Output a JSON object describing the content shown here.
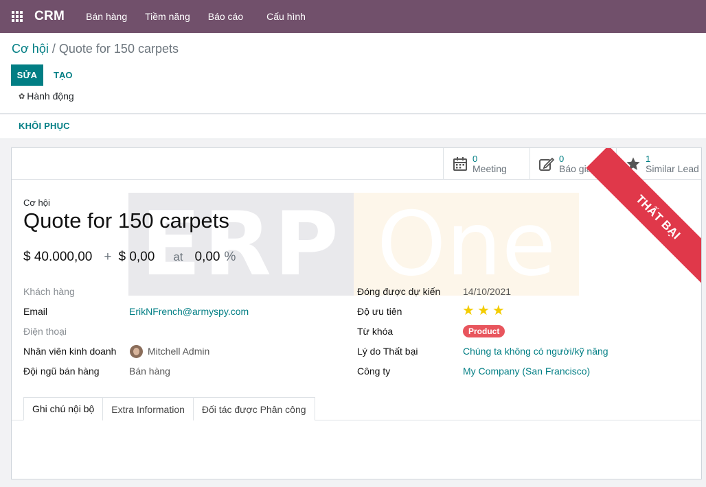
{
  "navbar": {
    "app_name": "CRM",
    "menu": [
      "Bán hàng",
      "Tiềm năng",
      "Báo cáo",
      "Cấu hình"
    ]
  },
  "breadcrumb": {
    "parent": "Cơ hội",
    "separator": "/",
    "current": "Quote for 150 carpets"
  },
  "buttons": {
    "edit": "SỬA",
    "create": "TẠO",
    "action": "Hành động",
    "restore": "KHÔI PHỤC"
  },
  "stat_buttons": [
    {
      "icon": "calendar-icon",
      "value": "0",
      "label": "Meeting"
    },
    {
      "icon": "edit-icon",
      "value": "0",
      "label": "Báo giá"
    },
    {
      "icon": "star-icon",
      "value": "1",
      "label": "Similar Lead"
    }
  ],
  "watermark": {
    "left": "ERP",
    "right": "One"
  },
  "ribbon": "THẤT BẠI",
  "record": {
    "type_label": "Cơ hội",
    "name": "Quote for 150 carpets",
    "expected_revenue": "$ 40.000,00",
    "plus": "+",
    "recurring_revenue": "$ 0,00",
    "at": "at",
    "probability": "0,00",
    "percent": "%"
  },
  "left_fields": {
    "customer_label": "Khách hàng",
    "email_label": "Email",
    "email_value": "ErikNFrench@armyspy.com",
    "phone_label": "Điện thoại",
    "salesperson_label": "Nhân viên kinh doanh",
    "salesperson_value": "Mitchell Admin",
    "team_label": "Đội ngũ bán hàng",
    "team_value": "Bán hàng"
  },
  "right_fields": {
    "deadline_label": "Đóng được dự kiến",
    "deadline_value": "14/10/2021",
    "priority_label": "Độ ưu tiên",
    "priority_stars": 3,
    "tags_label": "Từ khóa",
    "tag_value": "Product",
    "lost_reason_label": "Lý do Thất bại",
    "lost_reason_value": "Chúng ta không có người/kỹ năng",
    "company_label": "Công ty",
    "company_value": "My Company (San Francisco)"
  },
  "tabs": [
    "Ghi chú nội bộ",
    "Extra Information",
    "Đối tác được Phân công"
  ],
  "colors": {
    "navbar": "#71506b",
    "primary": "#017e84",
    "ribbon": "#e0384a",
    "tag": "#e8555d",
    "star": "#f3cc00"
  }
}
